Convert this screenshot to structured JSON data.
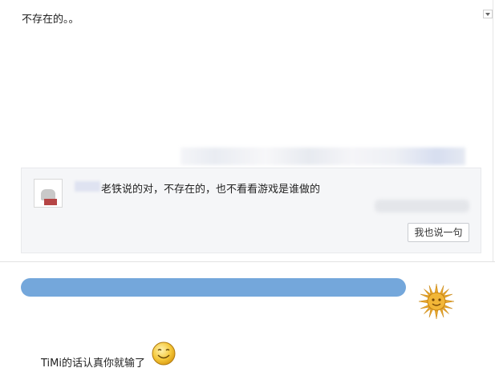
{
  "post": {
    "text": "不存在的。。"
  },
  "reply": {
    "text": "老铁说的对，不存在的，也不看看游戏是谁做的",
    "button_label": "我也说一句"
  },
  "comment": {
    "text": "TiMi的话认真你就输了"
  },
  "colors": {
    "accent_bar": "#74a7db",
    "reply_bg": "#f5f6f8"
  },
  "icons": {
    "collapse": "chevron-down-icon",
    "sun_emoji": "sun-emoji-icon",
    "smiley_emoji": "smile-emoji-icon"
  }
}
